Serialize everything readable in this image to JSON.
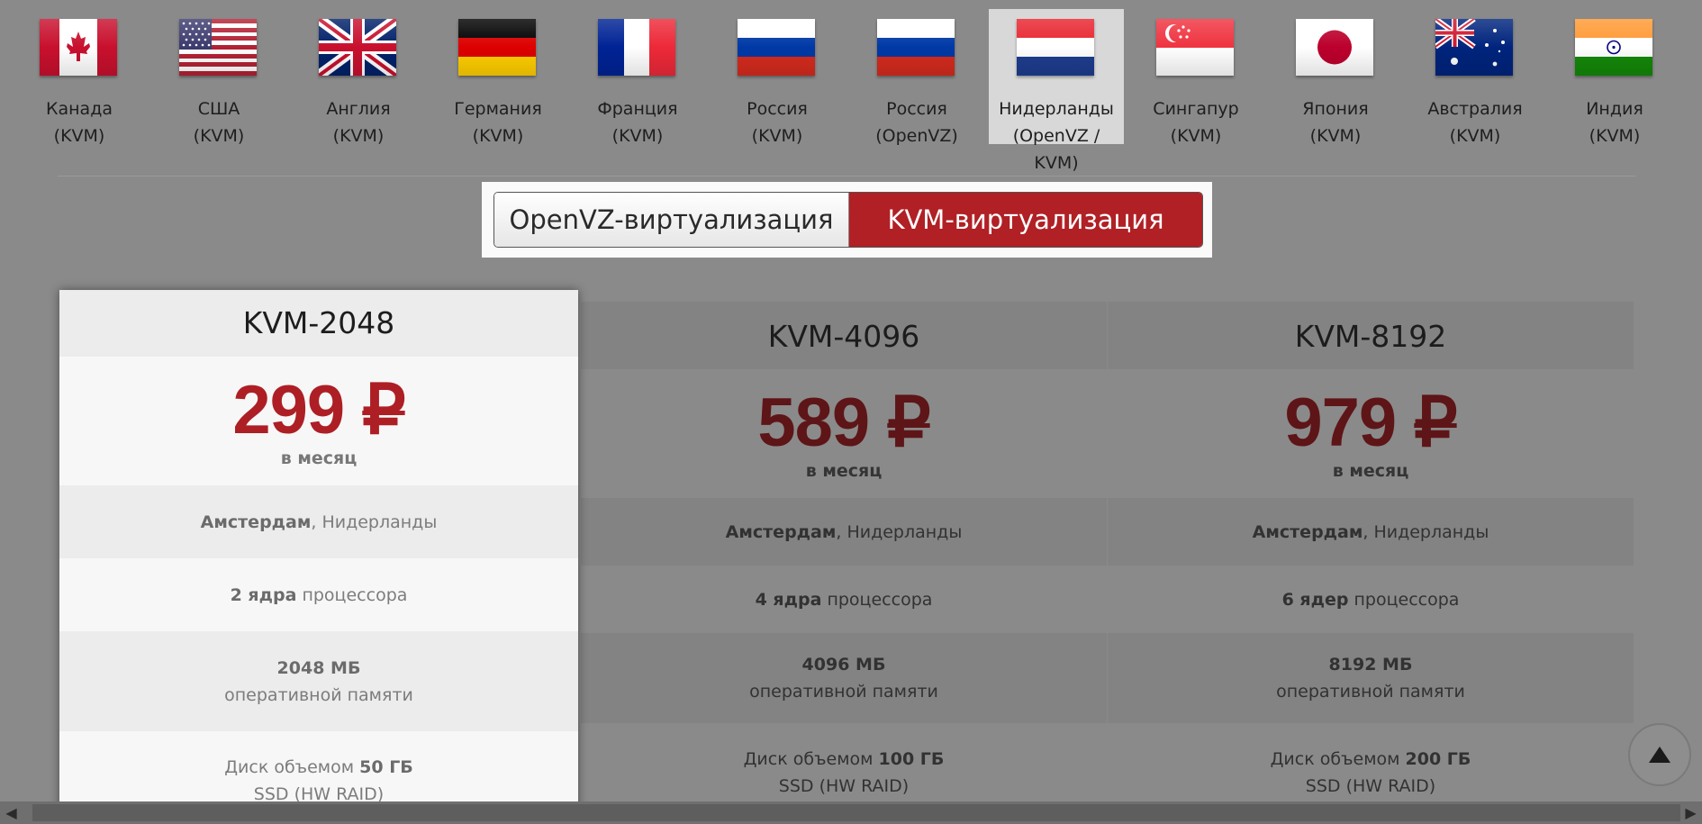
{
  "countries": [
    {
      "name": "Канада",
      "virt": "(KVM)",
      "flag": "canada-flag"
    },
    {
      "name": "США",
      "virt": "(KVM)",
      "flag": "usa-flag"
    },
    {
      "name": "Англия",
      "virt": "(KVM)",
      "flag": "uk-flag"
    },
    {
      "name": "Германия",
      "virt": "(KVM)",
      "flag": "germany-flag"
    },
    {
      "name": "Франция",
      "virt": "(KVM)",
      "flag": "france-flag"
    },
    {
      "name": "Россия",
      "virt": "(KVM)",
      "flag": "russia-flag"
    },
    {
      "name": "Россия",
      "virt": "(OpenVZ)",
      "flag": "russia-flag"
    },
    {
      "name": "Нидерланды",
      "virt": "(OpenVZ / KVM)",
      "flag": "netherlands-flag",
      "active": true
    },
    {
      "name": "Сингапур",
      "virt": "(KVM)",
      "flag": "singapore-flag"
    },
    {
      "name": "Япония",
      "virt": "(KVM)",
      "flag": "japan-flag"
    },
    {
      "name": "Австралия",
      "virt": "(KVM)",
      "flag": "australia-flag"
    },
    {
      "name": "Индия",
      "virt": "(KVM)",
      "flag": "india-flag"
    }
  ],
  "toggle": {
    "openvz_label": "OpenVZ-виртуализация",
    "kvm_label": "KVM-виртуализация",
    "selected": "kvm"
  },
  "plans": [
    {
      "title": "KVM-2048",
      "price": "299",
      "currency": "₽",
      "per": "в месяц",
      "city": "Амстердам",
      "country": ", Нидерланды",
      "cores_bold": "2 ядра",
      "cores_rest": " процессора",
      "ram_bold": "2048 МБ",
      "ram_rest": "оперативной памяти",
      "disk_pre": "Диск объемом ",
      "disk_bold": "50 ГБ",
      "disk_type": "SSD (HW RAID)"
    },
    {
      "title": "KVM-4096",
      "price": "589",
      "currency": "₽",
      "per": "в месяц",
      "city": "Амстердам",
      "country": ", Нидерланды",
      "cores_bold": "4 ядра",
      "cores_rest": " процессора",
      "ram_bold": "4096 МБ",
      "ram_rest": "оперативной памяти",
      "disk_pre": "Диск объемом ",
      "disk_bold": "100 ГБ",
      "disk_type": "SSD (HW RAID)"
    },
    {
      "title": "KVM-8192",
      "price": "979",
      "currency": "₽",
      "per": "в месяц",
      "city": "Амстердам",
      "country": ", Нидерланды",
      "cores_bold": "6 ядер",
      "cores_rest": " процессора",
      "ram_bold": "8192 МБ",
      "ram_rest": "оперативной памяти",
      "disk_pre": "Диск объемом ",
      "disk_bold": "200 ГБ",
      "disk_type": "SSD (HW RAID)"
    }
  ],
  "colors": {
    "accent": "#ad1f25",
    "overlay": "#8a8a8a"
  },
  "scroll_top_icon": "arrow-up-icon"
}
